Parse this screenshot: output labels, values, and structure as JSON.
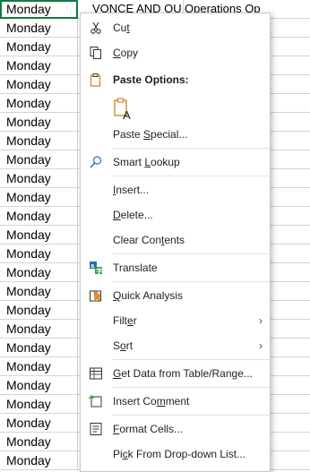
{
  "sheet": {
    "header_row": {
      "col_a": "Monday",
      "col_b": "VONCE AND OU",
      "col_c": "Operations   Op"
    },
    "column_a_value": "Monday",
    "row_count": 25
  },
  "context_menu": {
    "cut": {
      "label": "Cut",
      "accel_index": 2,
      "icon": "scissors-icon"
    },
    "copy": {
      "label": "Copy",
      "accel_index": 0,
      "icon": "copy-icon"
    },
    "paste_options": {
      "label": "Paste Options:",
      "icon": "clipboard-icon",
      "option_icon": "paste-keep-text-icon"
    },
    "paste_special": {
      "label": "Paste Special...",
      "accel_index": 6
    },
    "smart_lookup": {
      "label": "Smart Lookup",
      "accel_index": 6,
      "icon": "search-icon"
    },
    "insert": {
      "label": "Insert...",
      "accel_index": 0
    },
    "delete": {
      "label": "Delete...",
      "accel_index": 0
    },
    "clear_contents": {
      "label": "Clear Contents",
      "accel_index": 9
    },
    "translate": {
      "label": "Translate",
      "icon": "translate-icon"
    },
    "quick_analysis": {
      "label": "Quick Analysis",
      "accel_index": 0,
      "icon": "quick-analysis-icon"
    },
    "filter": {
      "label": "Filter",
      "accel_index": 4,
      "has_submenu": true
    },
    "sort": {
      "label": "Sort",
      "accel_index": 1,
      "has_submenu": true
    },
    "get_data": {
      "label": "Get Data from Table/Range...",
      "accel_index": 0,
      "icon": "table-icon"
    },
    "insert_comment": {
      "label": "Insert Comment",
      "accel_index": 9,
      "icon": "comment-icon"
    },
    "format_cells": {
      "label": "Format Cells...",
      "accel_index": 0,
      "icon": "format-cells-icon"
    },
    "pick_from_list": {
      "label": "Pick From Drop-down List...",
      "accel_index": 2
    },
    "submenu_arrow": "›"
  },
  "colors": {
    "selection_border": "#107c41",
    "gridline": "#d4d4d4",
    "menu_border": "#c8c8c8"
  }
}
